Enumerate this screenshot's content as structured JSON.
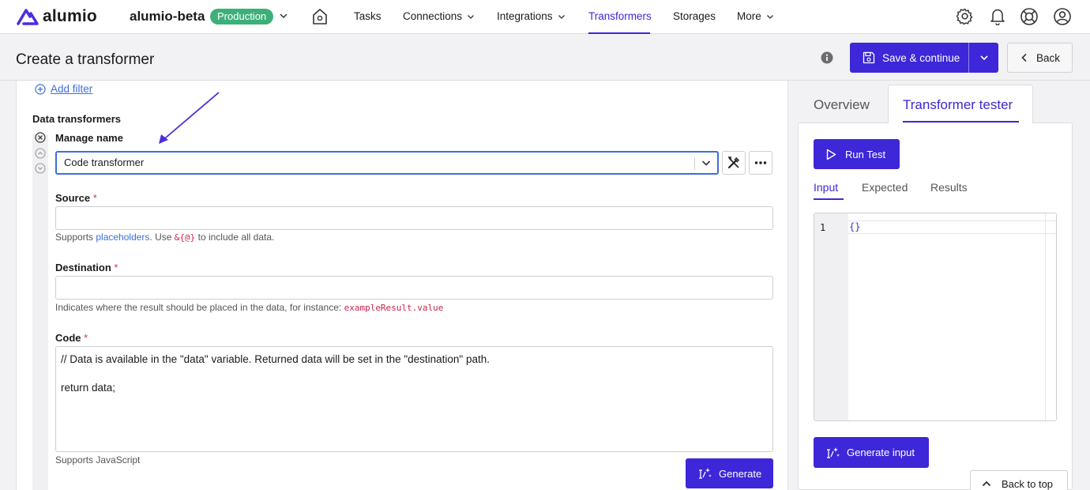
{
  "brand": {
    "logo_text": "alumio"
  },
  "environment": {
    "name": "alumio-beta",
    "badge": "Production",
    "badge_color": "#3db07a"
  },
  "nav": {
    "items": [
      {
        "label": "Tasks",
        "has_dropdown": false,
        "active": false
      },
      {
        "label": "Connections",
        "has_dropdown": true,
        "active": false
      },
      {
        "label": "Integrations",
        "has_dropdown": true,
        "active": false
      },
      {
        "label": "Transformers",
        "has_dropdown": false,
        "active": true
      },
      {
        "label": "Storages",
        "has_dropdown": false,
        "active": false
      },
      {
        "label": "More",
        "has_dropdown": true,
        "active": false
      }
    ],
    "icons": [
      "home-icon",
      "gear-icon",
      "bell-icon",
      "support-icon",
      "user-icon"
    ],
    "accent_color": "#3d27d8"
  },
  "header": {
    "title": "Create a transformer",
    "save_label": "Save & continue",
    "back_label": "Back"
  },
  "form": {
    "add_filter_label": "Add filter",
    "data_transformers_label": "Data transformers",
    "manage_name_label": "Manage name",
    "transformer_select_value": "Code transformer",
    "source": {
      "label": "Source",
      "required_mark": "*",
      "value": "",
      "help_prefix": "Supports",
      "help_link": "placeholders",
      "help_middle": ". Use",
      "help_code": "&{@}",
      "help_suffix": "to include all data."
    },
    "destination": {
      "label": "Destination",
      "required_mark": "*",
      "value": "",
      "help_text": "Indicates where the result should be placed in the data, for instance:",
      "help_code": "exampleResult.value"
    },
    "code": {
      "label": "Code",
      "required_mark": "*",
      "value": "// Data is available in the \"data\" variable. Returned data will be set in the \"destination\" path.\n\nreturn data;",
      "help_text": "Supports JavaScript"
    },
    "generate_label": "Generate"
  },
  "tester": {
    "tabs": [
      {
        "label": "Overview",
        "active": false
      },
      {
        "label": "Transformer tester",
        "active": true
      }
    ],
    "run_label": "Run Test",
    "subtabs": [
      {
        "label": "Input",
        "active": true
      },
      {
        "label": "Expected",
        "active": false
      },
      {
        "label": "Results",
        "active": false
      }
    ],
    "editor": {
      "line_number": "1",
      "content": "{}"
    },
    "generate_input_label": "Generate input",
    "back_to_top_label": "Back to top"
  }
}
